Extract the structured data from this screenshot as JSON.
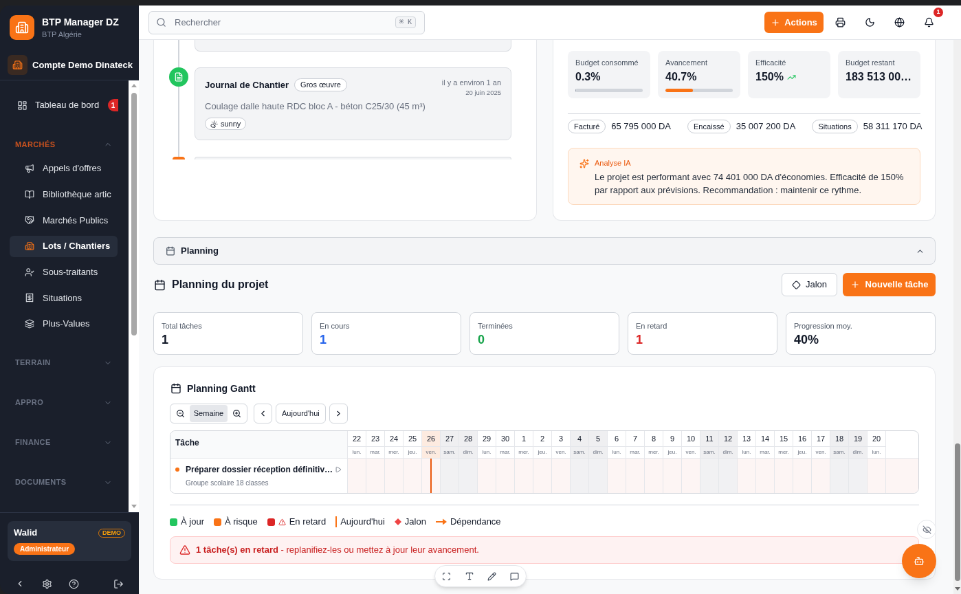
{
  "sidebar": {
    "brand": {
      "name": "BTP Manager DZ",
      "subtitle": "BTP Algérie"
    },
    "account": {
      "name": "Compte Demo Dinateck"
    },
    "items": [
      {
        "label": "Tableau de bord",
        "badge": "1",
        "selected": false
      }
    ],
    "sections": [
      {
        "label": "MARCHÉS",
        "expanded": true,
        "items": [
          {
            "label": "Appels d'offres",
            "selected": false
          },
          {
            "label": "Bibliothèque artic",
            "selected": false
          },
          {
            "label": "Marchés Publics",
            "selected": false
          },
          {
            "label": "Lots / Chantiers",
            "selected": true
          },
          {
            "label": "Sous-traitants",
            "selected": false
          },
          {
            "label": "Situations",
            "selected": false
          },
          {
            "label": "Plus-Values",
            "selected": false
          }
        ]
      },
      {
        "label": "TERRAIN",
        "expanded": false
      },
      {
        "label": "APPRO",
        "expanded": false
      },
      {
        "label": "FINANCE",
        "expanded": false
      },
      {
        "label": "DOCUMENTS",
        "expanded": false
      }
    ],
    "user": {
      "name": "Walid",
      "badge": "DEMO",
      "role": "Administrateur"
    }
  },
  "topbar": {
    "search": {
      "placeholder": "Rechercher",
      "shortcut": "⌘ K"
    },
    "actions_button": "Actions",
    "notifications": {
      "count": "1"
    }
  },
  "timeline": {
    "entries": [
      {
        "kind": "clipped_above"
      },
      {
        "kind": "journal",
        "color": "#22c55e",
        "title": "Journal de Chantier",
        "tag": "Gros œuvre",
        "time": "il y a environ 1 an",
        "date": "20 juin 2025",
        "description": "Coulage dalle haute RDC bloc A - béton C25/30 (45 m³)",
        "weather": "sunny"
      },
      {
        "kind": "clipped_below",
        "color": "#f97316"
      }
    ]
  },
  "performance": {
    "metrics": [
      {
        "kind": "bar",
        "label": "Budget consommé",
        "value": "0.3%",
        "level": 0.003,
        "color": "#9ca3af"
      },
      {
        "kind": "bar",
        "label": "Avancement",
        "value": "40.7%",
        "level": 0.407,
        "color": "#f97316"
      },
      {
        "kind": "trend",
        "label": "Efficacité",
        "value": "150%"
      },
      {
        "kind": "plain",
        "label": "Budget restant",
        "value": "183 513 00…"
      }
    ],
    "amounts": [
      {
        "label": "Facturé",
        "value": "65 795 000 DA"
      },
      {
        "label": "Encaissé",
        "value": "35 007 200 DA"
      },
      {
        "label": "Situations",
        "value": "58 311 170 DA"
      }
    ],
    "analysis": {
      "title": "Analyse IA",
      "text": "Le projet est performant avec 74 401 000 DA d'économies. Efficacité de 150% par rapport aux prévisions. Recommandation : maintenir ce rythme."
    }
  },
  "planning": {
    "section": {
      "title": "Planning",
      "expanded": true
    },
    "title": "Planning du projet",
    "buttons": {
      "milestone": "Jalon",
      "new_task": "Nouvelle tâche"
    },
    "stats": [
      {
        "label": "Total tâches",
        "value": "1",
        "color": "#111827"
      },
      {
        "label": "En cours",
        "value": "1",
        "color": "#2563eb"
      },
      {
        "label": "Terminées",
        "value": "0",
        "color": "#16a34a"
      },
      {
        "label": "En retard",
        "value": "1",
        "color": "#dc2626"
      },
      {
        "label": "Progression moy.",
        "value": "40%",
        "color": "#111827"
      }
    ],
    "gantt": {
      "title": "Planning Gantt",
      "zoom_label": "Semaine",
      "today_button": "Aujourd'hui",
      "task_column": "Tâche",
      "days": [
        {
          "date": "22",
          "weekday": "lun.",
          "weekend": false,
          "today": false
        },
        {
          "date": "23",
          "weekday": "mar.",
          "weekend": false,
          "today": false
        },
        {
          "date": "24",
          "weekday": "mer.",
          "weekend": false,
          "today": false
        },
        {
          "date": "25",
          "weekday": "jeu.",
          "weekend": false,
          "today": false
        },
        {
          "date": "26",
          "weekday": "ven.",
          "weekend": false,
          "today": true
        },
        {
          "date": "27",
          "weekday": "sam.",
          "weekend": true,
          "today": false
        },
        {
          "date": "28",
          "weekday": "dim.",
          "weekend": true,
          "today": false
        },
        {
          "date": "29",
          "weekday": "lun.",
          "weekend": false,
          "today": false
        },
        {
          "date": "30",
          "weekday": "mar.",
          "weekend": false,
          "today": false
        },
        {
          "date": "1",
          "weekday": "mer.",
          "weekend": false,
          "today": false
        },
        {
          "date": "2",
          "weekday": "jeu.",
          "weekend": false,
          "today": false
        },
        {
          "date": "3",
          "weekday": "ven.",
          "weekend": false,
          "today": false
        },
        {
          "date": "4",
          "weekday": "sam.",
          "weekend": true,
          "today": false
        },
        {
          "date": "5",
          "weekday": "dim.",
          "weekend": true,
          "today": false
        },
        {
          "date": "6",
          "weekday": "lun.",
          "weekend": false,
          "today": false
        },
        {
          "date": "7",
          "weekday": "mar.",
          "weekend": false,
          "today": false
        },
        {
          "date": "8",
          "weekday": "mer.",
          "weekend": false,
          "today": false
        },
        {
          "date": "9",
          "weekday": "jeu.",
          "weekend": false,
          "today": false
        },
        {
          "date": "10",
          "weekday": "ven.",
          "weekend": false,
          "today": false
        },
        {
          "date": "11",
          "weekday": "sam.",
          "weekend": true,
          "today": false
        },
        {
          "date": "12",
          "weekday": "dim.",
          "weekend": true,
          "today": false
        },
        {
          "date": "13",
          "weekday": "lun.",
          "weekend": false,
          "today": false
        },
        {
          "date": "14",
          "weekday": "mar.",
          "weekend": false,
          "today": false
        },
        {
          "date": "15",
          "weekday": "mer.",
          "weekend": false,
          "today": false
        },
        {
          "date": "16",
          "weekday": "jeu.",
          "weekend": false,
          "today": false
        },
        {
          "date": "17",
          "weekday": "ven.",
          "weekend": false,
          "today": false
        },
        {
          "date": "18",
          "weekday": "sam.",
          "weekend": true,
          "today": false
        },
        {
          "date": "19",
          "weekday": "dim.",
          "weekend": true,
          "today": false
        },
        {
          "date": "20",
          "weekday": "lun.",
          "weekend": false,
          "today": false
        }
      ],
      "tasks": [
        {
          "name": "Préparer dossier réception définitiv…",
          "project": "Groupe scolaire 18 classes",
          "color": "#f97316",
          "late": true
        }
      ],
      "legend": [
        {
          "kind": "square",
          "color": "#22c55e",
          "label": "À jour"
        },
        {
          "kind": "square",
          "color": "#f97316",
          "label": "À risque"
        },
        {
          "kind": "square-alert",
          "color": "#dc2626",
          "label": "En retard"
        },
        {
          "kind": "line",
          "color": "#f97316",
          "label": "Aujourd'hui"
        },
        {
          "kind": "diamond",
          "color": "#ef4444",
          "label": "Jalon"
        },
        {
          "kind": "arrow",
          "color": "#f97316",
          "label": "Dépendance"
        }
      ],
      "alert": "**1 tâche(s) en retard** - replanifiez-les ou mettez à jour leur avancement."
    }
  }
}
